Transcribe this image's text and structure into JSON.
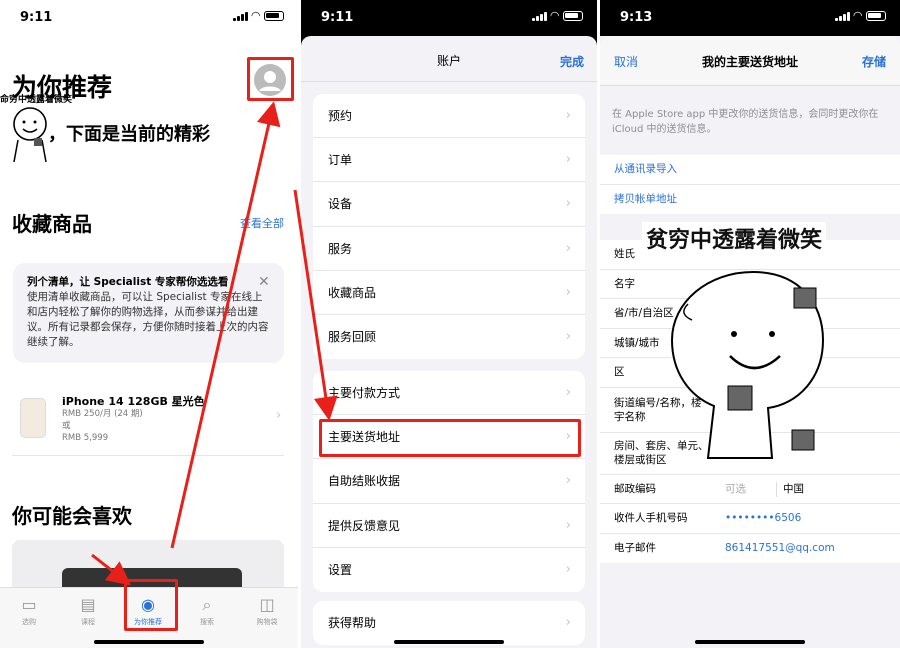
{
  "colors": {
    "accent": "#2b72d6",
    "red": "#e8201a"
  },
  "p1": {
    "time": "9:11",
    "title": "为你推荐",
    "avatar_icon": "person-circle-icon",
    "sticker_top": "命穷中透露着微笑",
    "sticker_main": "，下面是当前的精彩",
    "favorites_heading": "收藏商品",
    "see_all": "查看全部",
    "card_title": "列个清单，让 Specialist 专家帮你选选看",
    "card_body": "使用清单收藏商品，可以让 Specialist 专家在线上和店内轻松了解你的购物选择，从而参谋并给出建议。所有记录都会保存，方便你随时接着上次的内容继续了解。",
    "product_name": "iPhone 14 128GB 星光色",
    "product_monthly": "RMB 250/月 (24 期)",
    "product_or": "或",
    "product_price": "RMB 5,999",
    "like_heading": "你可能会喜欢",
    "tabs": [
      {
        "label": "选购",
        "icon": "laptop-icon"
      },
      {
        "label": "课程",
        "icon": "calendar-icon"
      },
      {
        "label": "为你推荐",
        "icon": "person-icon"
      },
      {
        "label": "搜索",
        "icon": "search-icon"
      },
      {
        "label": "购物袋",
        "icon": "bag-icon"
      }
    ]
  },
  "p2": {
    "time": "9:11",
    "title": "账户",
    "done": "完成",
    "group1": [
      "预约",
      "订单",
      "设备",
      "服务",
      "收藏商品",
      "服务回顾"
    ],
    "group2": [
      "主要付款方式",
      "主要送货地址",
      "自助结账收据",
      "提供反馈意见",
      "设置"
    ],
    "group3": [
      "获得帮助"
    ]
  },
  "p3": {
    "time": "9:13",
    "cancel": "取消",
    "title": "我的主要送货地址",
    "save": "存储",
    "info": "在 Apple Store app 中更改你的送货信息，会同时更改你在 iCloud 中的送货信息。",
    "import_contacts": "从通讯录导入",
    "copy_account": "拷贝帐单地址",
    "sticker_title": "贫穷中透露着微笑",
    "fields": [
      {
        "label": "姓氏",
        "value": ""
      },
      {
        "label": "名字",
        "value": ""
      },
      {
        "label": "省/市/自治区",
        "value": ""
      },
      {
        "label": "城镇/城市",
        "value": ""
      },
      {
        "label": "区",
        "value": ""
      }
    ],
    "street_label": "街道编号/名称，楼宇名称",
    "room_label": "房间、套房、单元、楼层或街区",
    "room_hint": "可选",
    "postcode_label": "邮政编码",
    "postcode_hint": "可选",
    "country": "中国",
    "phone_label": "收件人手机号码",
    "phone_value": "••••••••6506",
    "email_label": "电子邮件",
    "email_value": "861417551@qq.com"
  }
}
